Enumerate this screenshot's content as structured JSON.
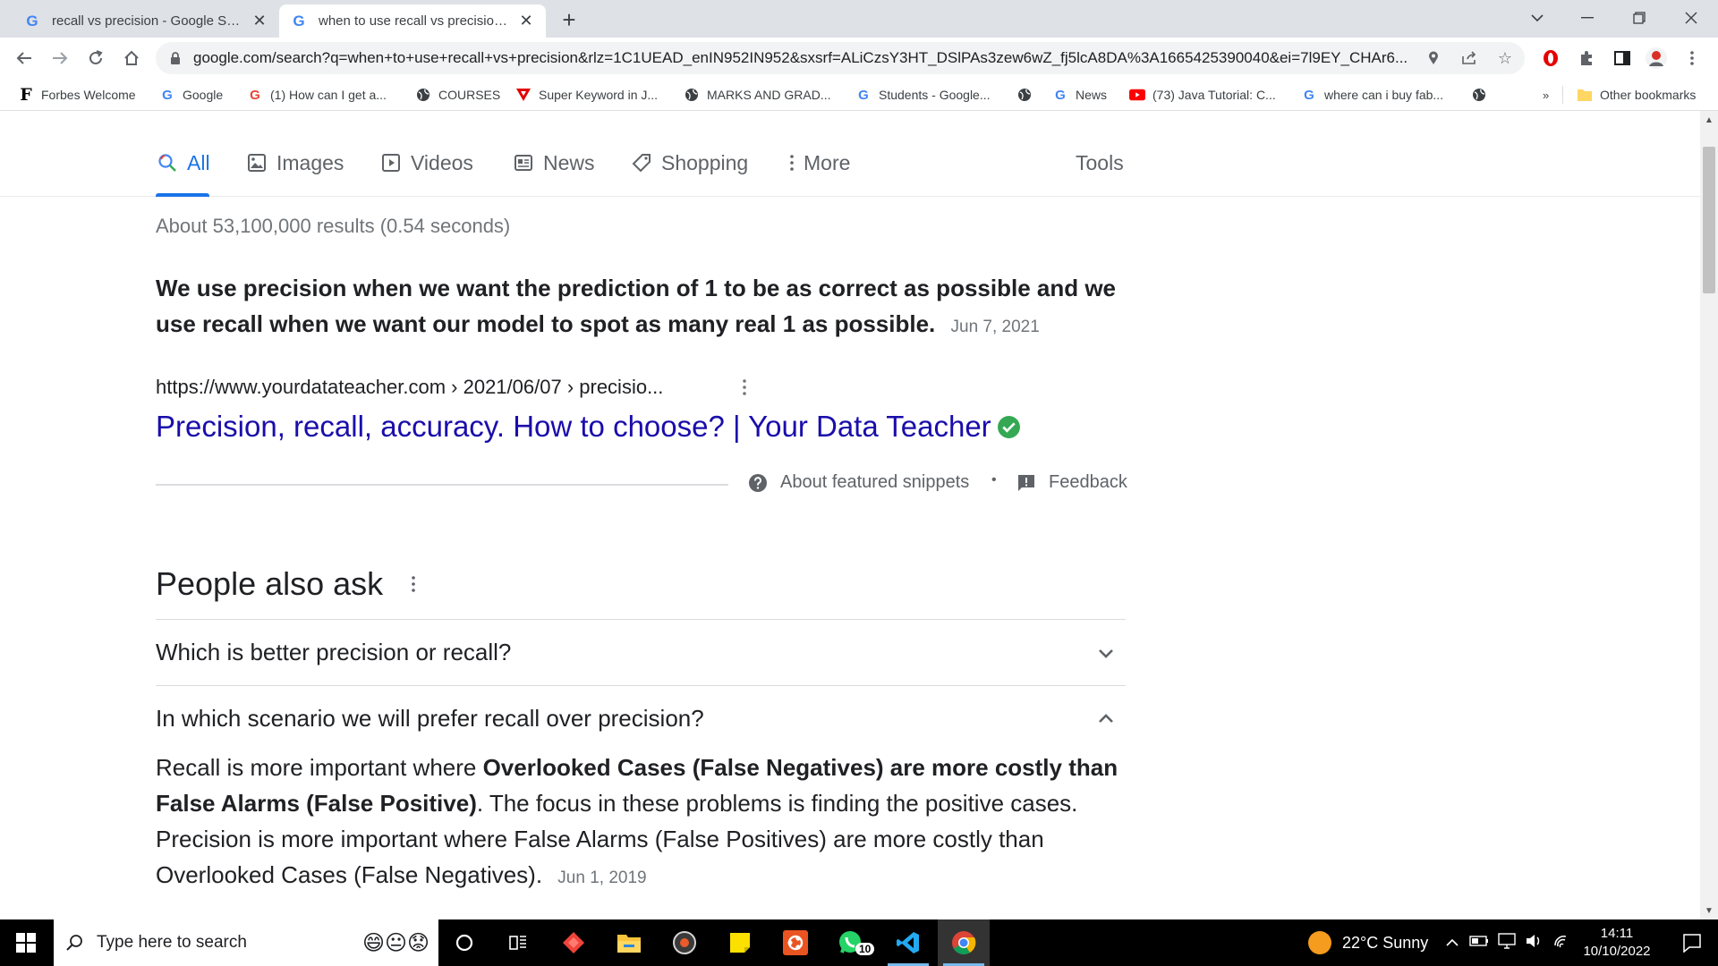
{
  "browser": {
    "tabs": [
      {
        "title": "recall vs precision - Google Search",
        "active": false
      },
      {
        "title": "when to use recall vs precision - Google Search",
        "active": true
      }
    ],
    "url": "google.com/search?q=when+to+use+recall+vs+precision&rlz=1C1UEAD_enIN952IN952&sxsrf=ALiCzsY3HT_DSlPAs3zew6wZ_fj5lcA8DA%3A1665425390040&ei=7l9EY_CHAr6...",
    "bookmarks": [
      {
        "label": "Forbes Welcome",
        "icon": "forbes-icon"
      },
      {
        "label": "Google",
        "icon": "google-icon"
      },
      {
        "label": "(1) How can I get a...",
        "icon": "google-icon"
      },
      {
        "label": "COURSES",
        "icon": "globe-icon"
      },
      {
        "label": "Super Keyword in J...",
        "icon": "triangle-icon"
      },
      {
        "label": "MARKS AND GRAD...",
        "icon": "globe-icon"
      },
      {
        "label": "Students - Google...",
        "icon": "google-icon"
      },
      {
        "label": "",
        "icon": "globe-icon"
      },
      {
        "label": "News",
        "icon": "google-icon"
      },
      {
        "label": "(73) Java Tutorial: C...",
        "icon": "youtube-icon"
      },
      {
        "label": "where can i buy fab...",
        "icon": "google-icon"
      },
      {
        "label": "",
        "icon": "globe-icon"
      }
    ],
    "bookmarks_overflow": "»",
    "other_bookmarks": "Other bookmarks"
  },
  "search": {
    "tabs": {
      "all": "All",
      "images": "Images",
      "videos": "Videos",
      "news": "News",
      "shopping": "Shopping",
      "more": "More",
      "tools": "Tools"
    },
    "result_stats": "About 53,100,000 results (0.54 seconds)",
    "featured_snippet": {
      "answer": "We use precision when we want the prediction of 1 to be as correct as possible and we use recall when we want our model to spot as many real 1 as possible.",
      "date": "Jun 7, 2021",
      "cite": "https://www.yourdatateacher.com › 2021/06/07 › precisio...",
      "title": "Precision, recall, accuracy. How to choose? | Your Data Teacher",
      "about": "About featured snippets",
      "separator": "•",
      "feedback": "Feedback"
    },
    "people_also_ask": {
      "heading": "People also ask",
      "questions": [
        {
          "q": "Which is better precision or recall?",
          "expanded": false
        },
        {
          "q": "In which scenario we will prefer recall over precision?",
          "expanded": true
        }
      ],
      "answer": {
        "part1": "Recall is more important where ",
        "bold1": "Overlooked Cases (False Negatives) are more costly than False Alarms (False Positive)",
        "part2": ". The focus in these problems is finding the positive cases. Precision is more important where False Alarms (False Positives) are more costly than Overlooked Cases (False Negatives).",
        "date": "Jun 1, 2019"
      }
    }
  },
  "taskbar": {
    "search_placeholder": "Type here to search",
    "whatsapp_badge": "10",
    "weather": "22°C  Sunny",
    "time": "14:11",
    "date": "10/10/2022"
  },
  "colors": {
    "link": "#1a0dab",
    "accent": "#1a73e8",
    "verified": "#34a853"
  }
}
